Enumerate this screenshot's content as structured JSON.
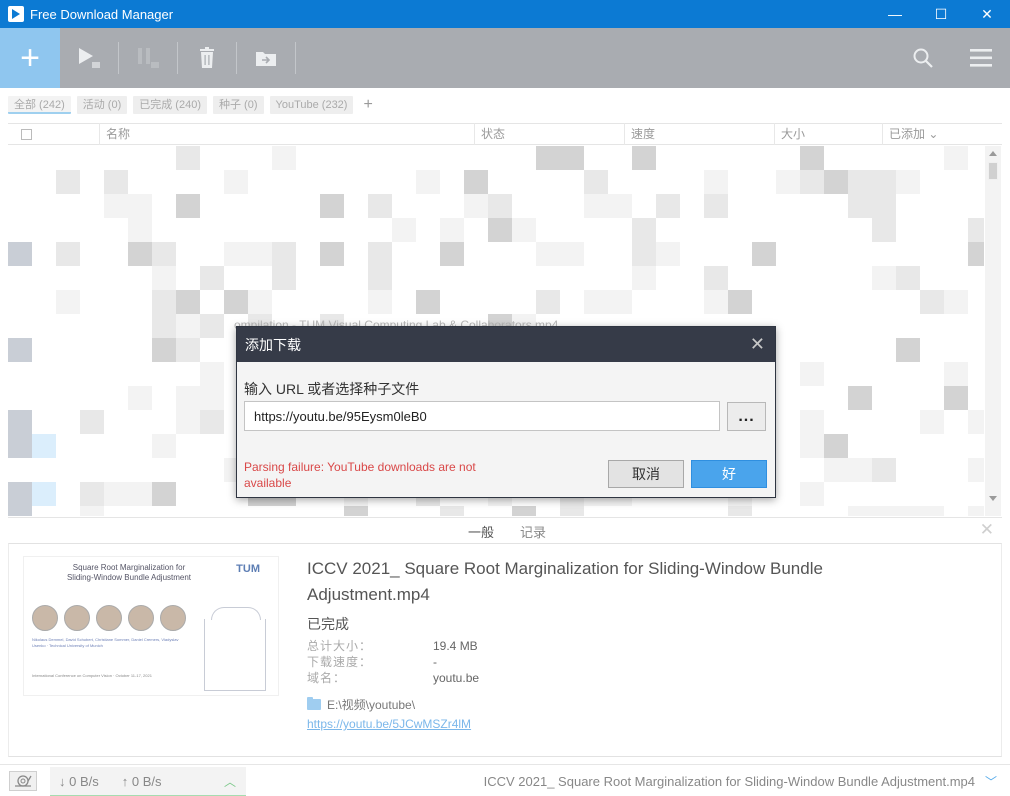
{
  "window": {
    "title": "Free Download Manager",
    "minimize_glyph": "—",
    "maximize_glyph": "☐",
    "close_glyph": "✕"
  },
  "toolbar": {
    "add_glyph": "+",
    "buttons": [
      "play-icon",
      "pause-icon",
      "delete-icon",
      "move-folder-icon"
    ],
    "right_buttons": [
      "search-icon",
      "menu-icon"
    ]
  },
  "filters": {
    "tabs": [
      {
        "label": "全部 (242)",
        "active": true
      },
      {
        "label": "活动 (0)",
        "active": false
      },
      {
        "label": "已完成 (240)",
        "active": false
      },
      {
        "label": "种子 (0)",
        "active": false
      },
      {
        "label": "YouTube (232)",
        "active": false
      }
    ],
    "add_glyph": "+"
  },
  "table": {
    "columns": {
      "name": "名称",
      "status": "状态",
      "speed": "速度",
      "size": "大小",
      "added": "已添加 ⌄"
    },
    "faded_row_text": "ompilation - TUM Visual Computing Lab & Collaborators.mp4"
  },
  "dialog": {
    "title": "添加下载",
    "close_glyph": "✕",
    "label": "输入 URL 或者选择种子文件",
    "url_value": "https://youtu.be/95Eysm0leB0",
    "browse_label": "...",
    "error": "Parsing failure: YouTube downloads are not available",
    "cancel_label": "取消",
    "ok_label": "好"
  },
  "detail_tabs": {
    "general": "一般",
    "log": "记录",
    "close_glyph": "✕"
  },
  "detail": {
    "thumbnail": {
      "title_line1": "Square Root Marginalization for",
      "title_line2": "Sliding-Window Bundle Adjustment",
      "logo": "TUM",
      "authors": "Nikolaus Demmel, David Schubert, Christiane Sommer, Daniel Cremers, Vladyslav Usenko · Technical University of Munich",
      "conference": "International Conference on Computer Vision · October 11-17, 2021"
    },
    "file_name": "ICCV 2021_ Square Root Marginalization for Sliding-Window Bundle Adjustment.mp4",
    "status": "已完成",
    "rows": [
      {
        "key": "总计大小：",
        "value": "19.4 MB"
      },
      {
        "key": "下载速度：",
        "value": "-"
      },
      {
        "key": "域名：",
        "value": "youtu.be"
      }
    ],
    "folder": "E:\\视频\\youtube\\",
    "link": "https://youtu.be/5JCwMSZr4lM"
  },
  "statusbar": {
    "download_speed": "↓  0 B/s",
    "upload_speed": "↑  0 B/s",
    "expand_glyph": "︿",
    "current_file": "ICCV 2021_ Square Root Marginalization for Sliding-Window Bundle Adjustment.mp4",
    "dropdown_glyph": "﹀"
  },
  "colors": {
    "titlebar": "#0c7ad3",
    "toolbar": "#a9acb1",
    "accent": "#4aa4ec",
    "dialog_header": "#363b48",
    "error": "#d94848"
  }
}
